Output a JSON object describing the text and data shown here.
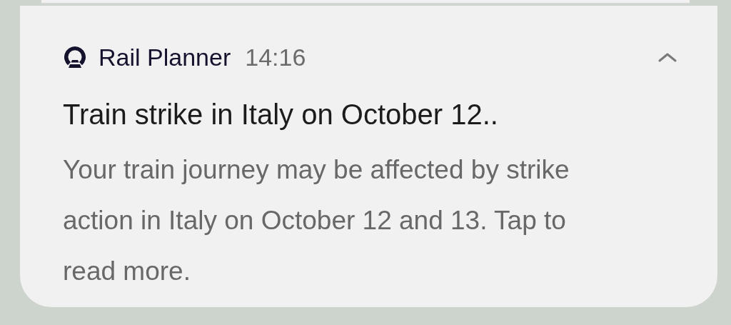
{
  "notification": {
    "app_name": "Rail Planner",
    "time": "14:16",
    "expanded": true,
    "title": "Train strike in Italy on October 12..",
    "body": "Your train journey may be affected by strike action in Italy on October 12 and 13. Tap to read more."
  }
}
